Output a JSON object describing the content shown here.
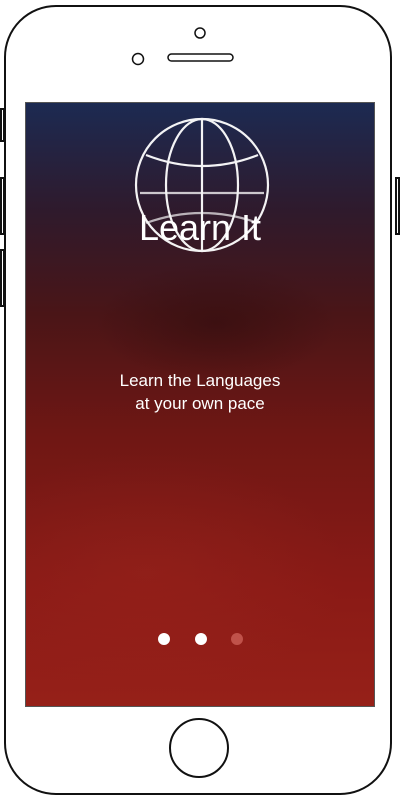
{
  "app": {
    "title": "Learn It",
    "tagline_line1": "Learn the Languages",
    "tagline_line2": "at your own pace"
  },
  "pager": {
    "count": 3,
    "active_index": 2,
    "colors": {
      "inactive": "#ffffff",
      "active": "#c0524a"
    }
  },
  "icons": {
    "logo": "globe-icon"
  }
}
